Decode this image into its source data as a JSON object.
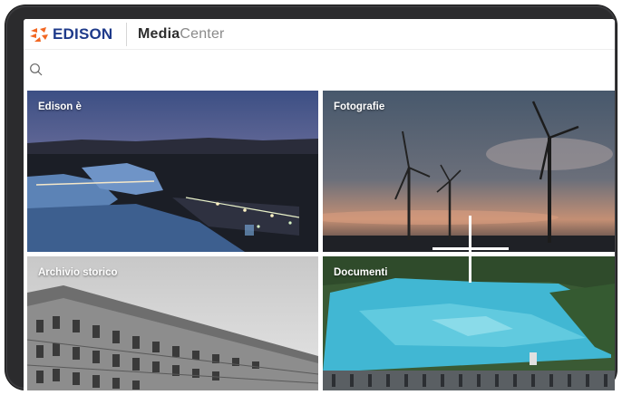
{
  "header": {
    "logo_text": "edison",
    "title_bold": "Media",
    "title_light": "Center",
    "brand_orange": "#f26722",
    "brand_blue": "#1e3a8a"
  },
  "search": {
    "icon": "search-icon"
  },
  "tiles": [
    {
      "label": "Edison è"
    },
    {
      "label": "Fotografie"
    },
    {
      "label": "Archivio storico"
    },
    {
      "label": "Documenti"
    }
  ]
}
